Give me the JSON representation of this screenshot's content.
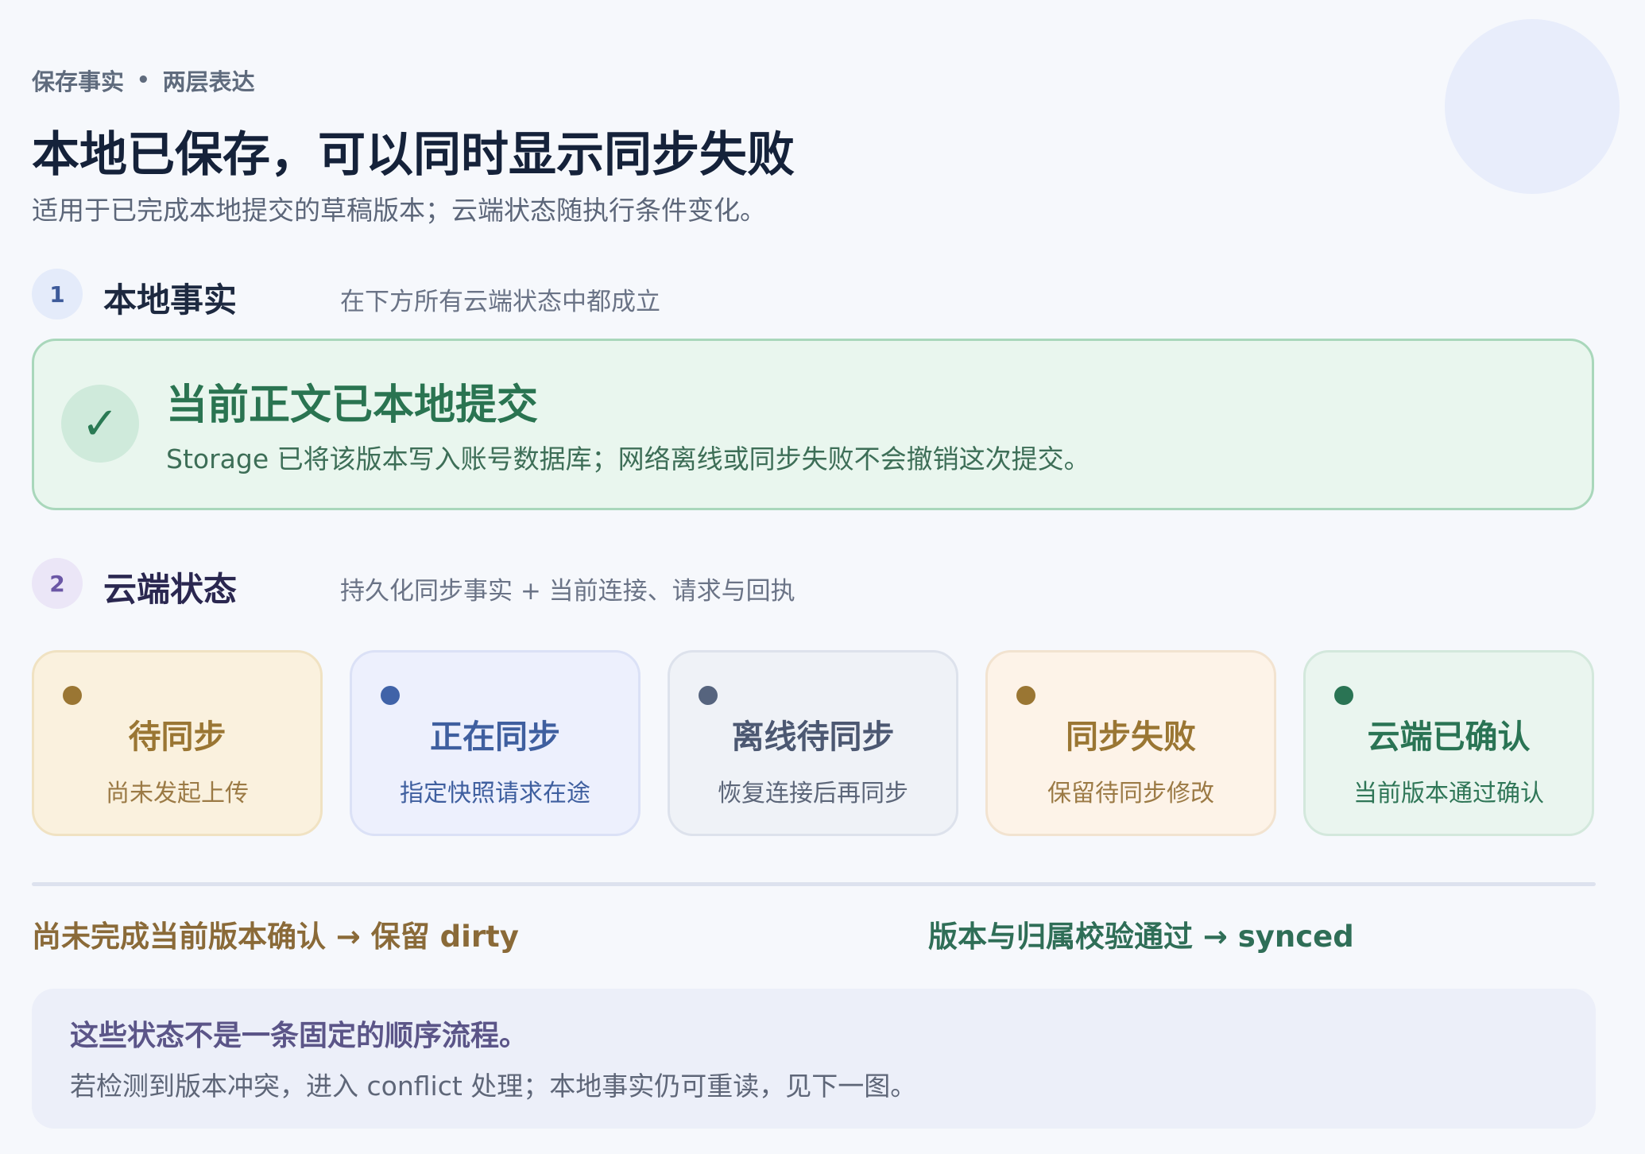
{
  "header": {
    "eyebrow_left": "保存事实",
    "eyebrow_sep": "•",
    "eyebrow_right": "两层表达",
    "title": "本地已保存，可以同时显示同步失败",
    "subtitle": "适用于已完成本地提交的草稿版本；云端状态随执行条件变化。"
  },
  "section1": {
    "number": "1",
    "title": "本地事实",
    "description": "在下方所有云端状态中都成立"
  },
  "local_fact": {
    "icon": "✓",
    "title": "当前正文已本地提交",
    "description": "Storage 已将该版本写入账号数据库；网络离线或同步失败不会撤销这次提交。"
  },
  "section2": {
    "number": "2",
    "title": "云端状态",
    "description": "持久化同步事实 + 当前连接、请求与回执"
  },
  "states": [
    {
      "title": "待同步",
      "description": "尚未发起上传",
      "accent": "#9a7633"
    },
    {
      "title": "正在同步",
      "description": "指定快照请求在途",
      "accent": "#4063a8"
    },
    {
      "title": "离线待同步",
      "description": "恢复连接后再同步",
      "accent": "#56647e"
    },
    {
      "title": "同步失败",
      "description": "保留待同步修改",
      "accent": "#9a7633"
    },
    {
      "title": "云端已确认",
      "description": "当前版本通过确认",
      "accent": "#2a7454"
    }
  ],
  "rules": {
    "left": "尚未完成当前版本确认 → 保留 dirty",
    "right": "版本与归属校验通过 → synced"
  },
  "note": {
    "title": "这些状态不是一条固定的顺序流程。",
    "description": "若检测到版本冲突，进入 conflict 处理；本地事实仍可重读，见下一图。"
  },
  "colors": {
    "background": "#f6f8fc",
    "success": "#2a7451",
    "warning": "#9a7633"
  }
}
